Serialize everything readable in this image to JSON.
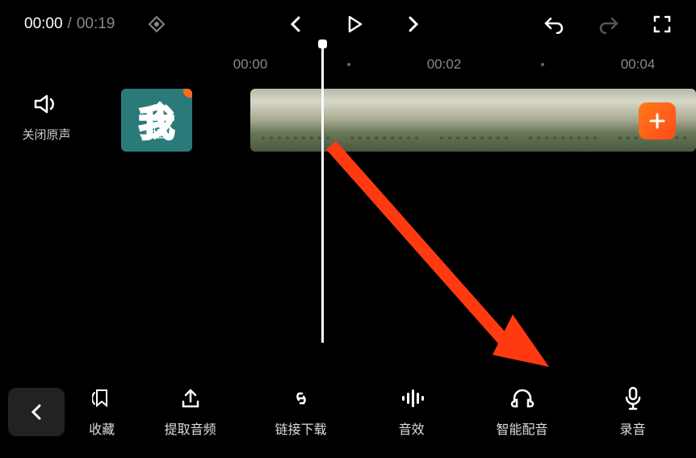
{
  "header": {
    "current_time": "00:00",
    "total_time": "00:19"
  },
  "ruler": {
    "marks": [
      {
        "label": "00:00",
        "pos": 310
      },
      {
        "label": "00:02",
        "pos": 550
      },
      {
        "label": "00:04",
        "pos": 790
      }
    ]
  },
  "timeline": {
    "sound_toggle_label": "关闭原声",
    "cover_text": "我",
    "cover_label": "封面"
  },
  "toolbar": {
    "items": [
      {
        "label": "收藏",
        "icon": "bookmark-icon"
      },
      {
        "label": "提取音频",
        "icon": "upload-icon"
      },
      {
        "label": "链接下载",
        "icon": "link-icon"
      },
      {
        "label": "音效",
        "icon": "sound-effect-icon"
      },
      {
        "label": "智能配音",
        "icon": "headset-icon"
      },
      {
        "label": "录音",
        "icon": "microphone-icon"
      }
    ]
  }
}
